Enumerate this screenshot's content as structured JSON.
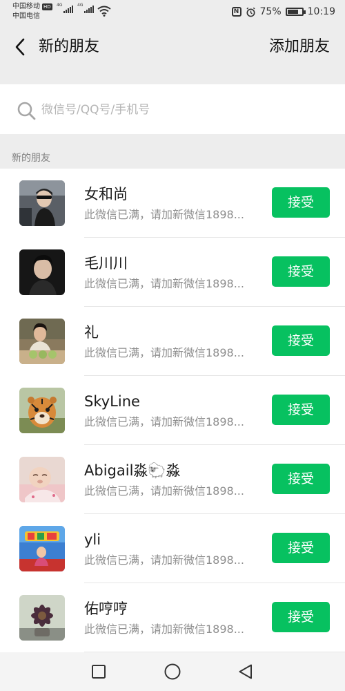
{
  "status_bar": {
    "carrier1": "中国移动",
    "carrier1_badge": "HD",
    "carrier2": "中国电信",
    "network1": "4G",
    "network2": "4G",
    "battery_percent": "75%",
    "battery_level": 0.75,
    "time": "10:19",
    "icons": [
      "nfc-icon",
      "alarm-icon",
      "battery-icon",
      "wifi-icon",
      "signal-icon"
    ]
  },
  "header": {
    "title": "新的朋友",
    "action_label": "添加朋友",
    "back_icon": "chevron-left-icon"
  },
  "search": {
    "placeholder": "微信号/QQ号/手机号",
    "value": ""
  },
  "section": {
    "title": "新的朋友"
  },
  "friends": [
    {
      "name": "女和尚",
      "message": "此微信已满，请加新微信1898...",
      "button": "接受"
    },
    {
      "name": "毛川川",
      "message": "此微信已满，请加新微信1898...",
      "button": "接受"
    },
    {
      "name": "礼",
      "message": "此微信已满，请加新微信1898...",
      "button": "接受"
    },
    {
      "name": "SkyLine",
      "message": "此微信已满，请加新微信1898...",
      "button": "接受"
    },
    {
      "name": "Abigail淼🐑淼",
      "message": "此微信已满，请加新微信1898...",
      "button": "接受"
    },
    {
      "name": "yli",
      "message": "此微信已满，请加新微信1898...",
      "button": "接受"
    },
    {
      "name": "佑哼哼",
      "message": "此微信已满，请加新微信1898...",
      "button": "接受"
    }
  ],
  "colors": {
    "accent": "#07c160",
    "background": "#ededed",
    "secondary_text": "#8e8e8e"
  },
  "nav": {
    "icons": [
      "square-icon",
      "circle-icon",
      "triangle-back-icon"
    ]
  }
}
